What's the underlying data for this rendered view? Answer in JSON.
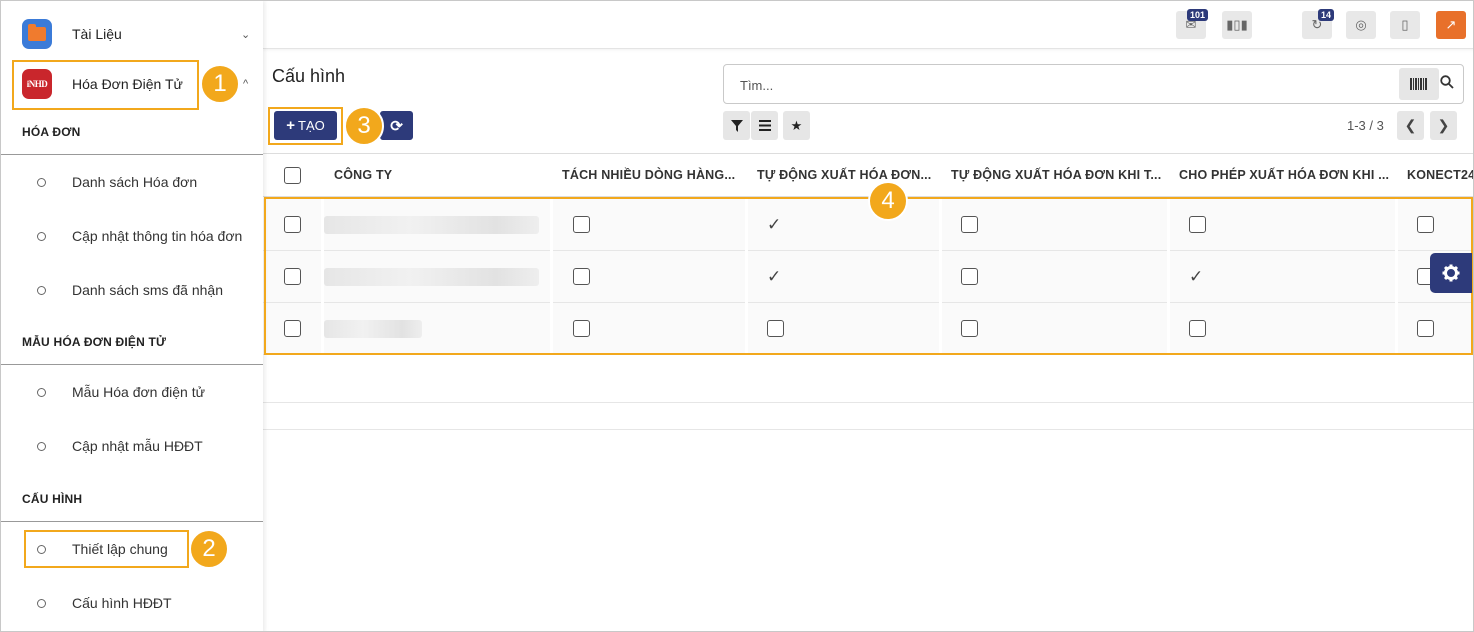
{
  "sidebar": {
    "apps": [
      {
        "label": "Tài Liệu",
        "icon": "folder-icon",
        "chevron": "⌄"
      },
      {
        "label": "Hóa Đơn Điện Tử",
        "icon": "invoice-app-icon",
        "icon_text": "iNHD",
        "chevron": "^"
      }
    ],
    "sections": [
      {
        "title": "HÓA ĐƠN",
        "items": [
          "Danh sách Hóa đơn",
          "Cập nhật thông tin hóa đơn",
          "Danh sách sms đã nhận"
        ]
      },
      {
        "title": "MẪU HÓA ĐƠN ĐIỆN TỬ",
        "items": [
          "Mẫu Hóa đơn điện tử",
          "Cập nhật mẫu HĐĐT"
        ]
      },
      {
        "title": "CẤU HÌNH",
        "items": [
          "Thiết lập chung",
          "Cấu hình HĐĐT"
        ]
      }
    ]
  },
  "annotations": [
    "1",
    "2",
    "3",
    "4"
  ],
  "topbar": {
    "chat_count": "101",
    "activity_count": "14"
  },
  "page": {
    "title": "Cấu hình",
    "search_placeholder": "Tìm...",
    "create_label": "TẠO",
    "pager": "1-3 / 3"
  },
  "table": {
    "columns": [
      "CÔNG TY",
      "TÁCH NHIỀU DÒNG HÀNG...",
      "TỰ ĐỘNG XUẤT HÓA ĐƠN...",
      "TỰ ĐỘNG XUẤT HÓA ĐƠN KHI T...",
      "CHO PHÉP XUẤT HÓA ĐƠN KHI ...",
      "KONECT24"
    ],
    "rows": [
      {
        "company_redacted": true,
        "values": [
          false,
          true,
          false,
          false,
          false
        ]
      },
      {
        "company_redacted": true,
        "values": [
          false,
          true,
          false,
          true,
          false
        ]
      },
      {
        "company_redacted": true,
        "values": [
          false,
          false,
          false,
          false,
          false
        ]
      }
    ]
  },
  "colors": {
    "primary": "#2d3a7a",
    "highlight": "#f2a81c",
    "invoice_app": "#c9262c"
  }
}
